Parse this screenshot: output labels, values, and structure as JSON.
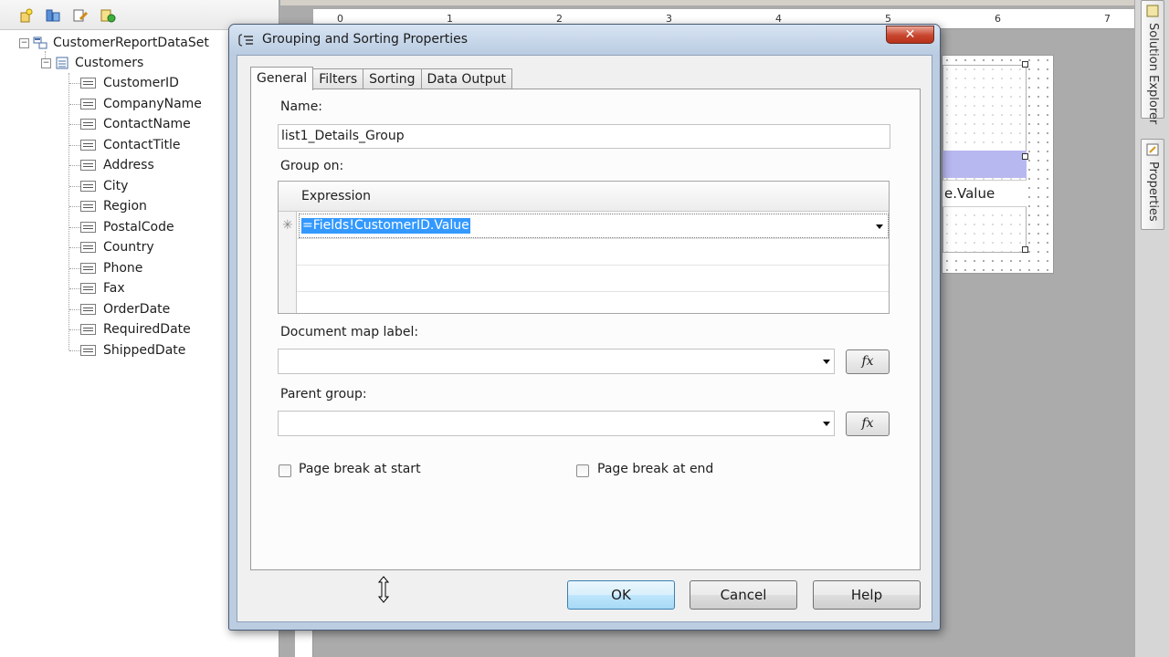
{
  "data_source_pane": {
    "dataset": "CustomerReportDataSet",
    "table": "Customers",
    "fields": [
      "CustomerID",
      "CompanyName",
      "ContactName",
      "ContactTitle",
      "Address",
      "City",
      "Region",
      "PostalCode",
      "Country",
      "Phone",
      "Fax",
      "OrderDate",
      "RequiredDate",
      "ShippedDate"
    ]
  },
  "designer": {
    "ruler_numbers": [
      "0",
      "1",
      "2",
      "3",
      "4",
      "5",
      "6",
      "7"
    ],
    "canvas_text": "e.Value"
  },
  "side_strip": {
    "tab1": "Solution Explorer",
    "tab2": "Properties"
  },
  "dialog": {
    "title": "Grouping and Sorting Properties",
    "close_glyph": "✕",
    "tabs": [
      "General",
      "Filters",
      "Sorting",
      "Data Output"
    ],
    "active_tab": "General",
    "name_label": "Name:",
    "name_value": "list1_Details_Group",
    "group_on_label": "Group on:",
    "grid_header": "Expression",
    "new_row_marker": "✳",
    "expression_value": "=Fields!CustomerID.Value",
    "document_map_label": "Document map label:",
    "document_map_value": "",
    "parent_group_label": "Parent group:",
    "parent_group_value": "",
    "fx_label": "fx",
    "page_break_start_label": "Page break at start",
    "page_break_start_checked": false,
    "page_break_end_label": "Page break at end",
    "page_break_end_checked": false,
    "ok_label": "OK",
    "cancel_label": "Cancel",
    "help_label": "Help"
  }
}
